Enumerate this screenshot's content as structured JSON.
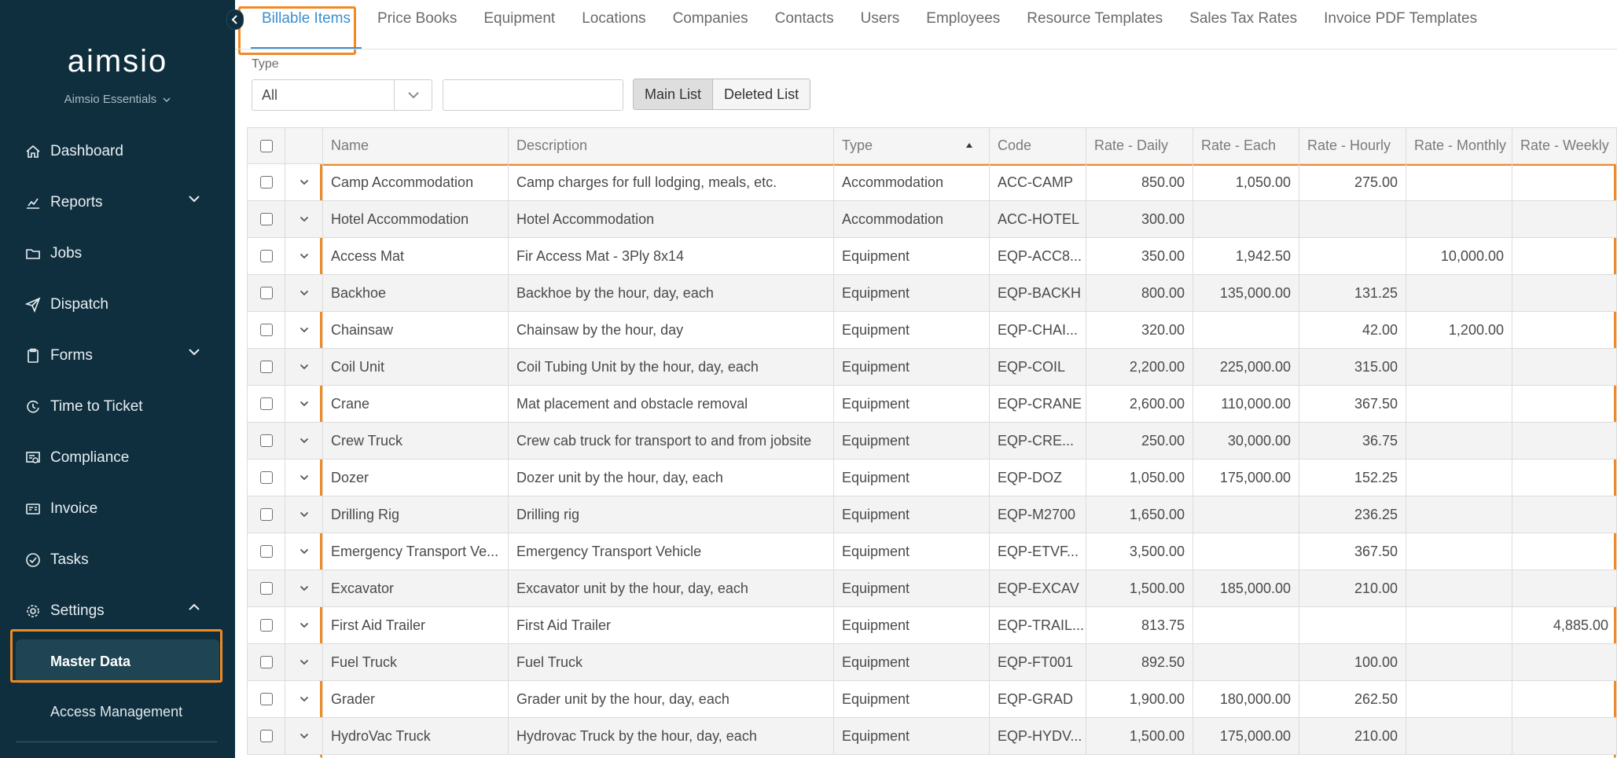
{
  "sidebar": {
    "logo": "aimsio",
    "org_name": "Aimsio Essentials",
    "items": [
      {
        "label": "Dashboard",
        "icon": "home-icon"
      },
      {
        "label": "Reports",
        "icon": "chart-icon",
        "expand": "chevron-down-icon"
      },
      {
        "label": "Jobs",
        "icon": "folder-icon"
      },
      {
        "label": "Dispatch",
        "icon": "paper-plane-icon"
      },
      {
        "label": "Forms",
        "icon": "clipboard-icon",
        "expand": "chevron-down-icon"
      },
      {
        "label": "Time to Ticket",
        "icon": "clock-refresh-icon"
      },
      {
        "label": "Compliance",
        "icon": "certificate-icon"
      },
      {
        "label": "Invoice",
        "icon": "invoice-icon"
      },
      {
        "label": "Tasks",
        "icon": "check-circle-icon"
      },
      {
        "label": "Settings",
        "icon": "gear-icon",
        "expand": "chevron-up-icon"
      }
    ],
    "sub_items": [
      {
        "label": "Master Data",
        "active": true
      },
      {
        "label": "Access Management",
        "active": false
      }
    ]
  },
  "tabs": [
    {
      "label": "Billable Items",
      "active": true
    },
    {
      "label": "Price Books"
    },
    {
      "label": "Equipment"
    },
    {
      "label": "Locations"
    },
    {
      "label": "Companies"
    },
    {
      "label": "Contacts"
    },
    {
      "label": "Users"
    },
    {
      "label": "Employees"
    },
    {
      "label": "Resource Templates"
    },
    {
      "label": "Sales Tax Rates"
    },
    {
      "label": "Invoice PDF Templates"
    }
  ],
  "filters": {
    "type_label": "Type",
    "type_value": "All",
    "search_value": "",
    "main_list": "Main List",
    "deleted_list": "Deleted List"
  },
  "grid": {
    "columns": [
      "Name",
      "Description",
      "Type",
      "Code",
      "Rate - Daily",
      "Rate - Each",
      "Rate - Hourly",
      "Rate - Monthly",
      "Rate - Weekly"
    ],
    "sort_column": "Type",
    "rows": [
      [
        "Camp Accommodation",
        "Camp charges for full lodging, meals, etc.",
        "Accommodation",
        "ACC-CAMP",
        "850.00",
        "1,050.00",
        "275.00",
        "",
        ""
      ],
      [
        "Hotel Accommodation",
        "Hotel Accommodation",
        "Accommodation",
        "ACC-HOTEL",
        "300.00",
        "",
        "",
        "",
        ""
      ],
      [
        "Access Mat",
        "Fir Access Mat - 3Ply 8x14",
        "Equipment",
        "EQP-ACC8...",
        "350.00",
        "1,942.50",
        "",
        "10,000.00",
        ""
      ],
      [
        "Backhoe",
        "Backhoe by the hour, day, each",
        "Equipment",
        "EQP-BACKH",
        "800.00",
        "135,000.00",
        "131.25",
        "",
        ""
      ],
      [
        "Chainsaw",
        "Chainsaw by the hour, day",
        "Equipment",
        "EQP-CHAI...",
        "320.00",
        "",
        "42.00",
        "1,200.00",
        ""
      ],
      [
        "Coil Unit",
        "Coil Tubing Unit by the hour, day, each",
        "Equipment",
        "EQP-COIL",
        "2,200.00",
        "225,000.00",
        "315.00",
        "",
        ""
      ],
      [
        "Crane",
        "Mat placement and obstacle removal",
        "Equipment",
        "EQP-CRANE",
        "2,600.00",
        "110,000.00",
        "367.50",
        "",
        ""
      ],
      [
        "Crew Truck",
        "Crew cab truck for transport to and from jobsite",
        "Equipment",
        "EQP-CRE...",
        "250.00",
        "30,000.00",
        "36.75",
        "",
        ""
      ],
      [
        "Dozer",
        "Dozer unit by the hour, day, each",
        "Equipment",
        "EQP-DOZ",
        "1,050.00",
        "175,000.00",
        "152.25",
        "",
        ""
      ],
      [
        "Drilling Rig",
        "Drilling rig",
        "Equipment",
        "EQP-M2700",
        "1,650.00",
        "",
        "236.25",
        "",
        ""
      ],
      [
        "Emergency Transport Ve...",
        "Emergency Transport Vehicle",
        "Equipment",
        "EQP-ETVF...",
        "3,500.00",
        "",
        "367.50",
        "",
        ""
      ],
      [
        "Excavator",
        "Excavator unit by the hour, day, each",
        "Equipment",
        "EQP-EXCAV",
        "1,500.00",
        "185,000.00",
        "210.00",
        "",
        ""
      ],
      [
        "First Aid Trailer",
        "First Aid Trailer",
        "Equipment",
        "EQP-TRAIL...",
        "813.75",
        "",
        "",
        "",
        "4,885.00"
      ],
      [
        "Fuel Truck",
        "Fuel Truck",
        "Equipment",
        "EQP-FT001",
        "892.50",
        "",
        "100.00",
        "",
        ""
      ],
      [
        "Grader",
        "Grader unit by the hour, day, each",
        "Equipment",
        "EQP-GRAD",
        "1,900.00",
        "180,000.00",
        "262.50",
        "",
        ""
      ],
      [
        "HydroVac Truck",
        "Hydrovac Truck by the hour, day, each",
        "Equipment",
        "EQP-HYDV...",
        "1,500.00",
        "175,000.00",
        "210.00",
        "",
        ""
      ]
    ]
  },
  "colors": {
    "sidebar_bg": "#0f2f3f",
    "accent": "#3d8ed0",
    "highlight": "#f08a24"
  }
}
